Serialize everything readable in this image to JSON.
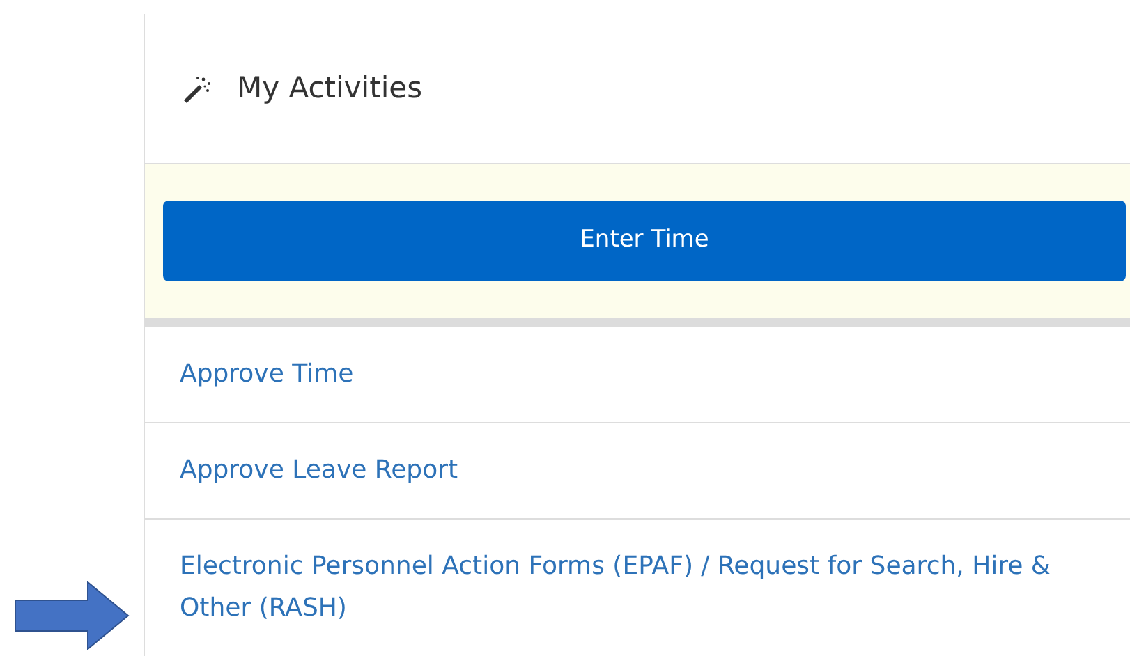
{
  "panel": {
    "title": "My Activities"
  },
  "primary_action": {
    "label": "Enter Time"
  },
  "activities": [
    {
      "label": "Approve Time"
    },
    {
      "label": "Approve Leave Report"
    },
    {
      "label": "Electronic Personnel Action Forms (EPAF) / Request for Search, Hire & Other (RASH)"
    }
  ]
}
